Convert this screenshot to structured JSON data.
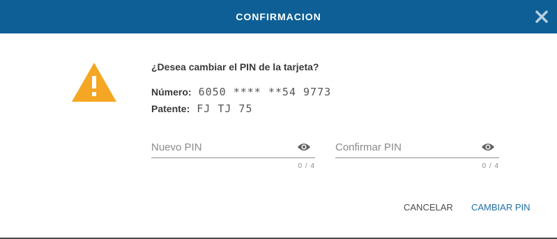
{
  "dialog": {
    "title": "CONFIRMACION",
    "close_icon": "close-icon"
  },
  "message": {
    "icon": "warning-icon",
    "question": "¿Desea cambiar el PIN de la tarjeta?",
    "numero_label": "Número:",
    "numero_value": "6050 **** **54 9773",
    "patente_label": "Patente:",
    "patente_value": "FJ TJ 75"
  },
  "fields": [
    {
      "placeholder": "Nuevo PIN",
      "value": "",
      "counter": "0 / 4",
      "icon": "eye-icon"
    },
    {
      "placeholder": "Confirmar PIN",
      "value": "",
      "counter": "0 / 4",
      "icon": "eye-icon"
    }
  ],
  "actions": {
    "cancel_label": "CANCELAR",
    "confirm_label": "CAMBIAR PIN"
  },
  "colors": {
    "header": "#0e5f96",
    "warning": "#f5a623",
    "primary_action": "#1f6ea5"
  }
}
